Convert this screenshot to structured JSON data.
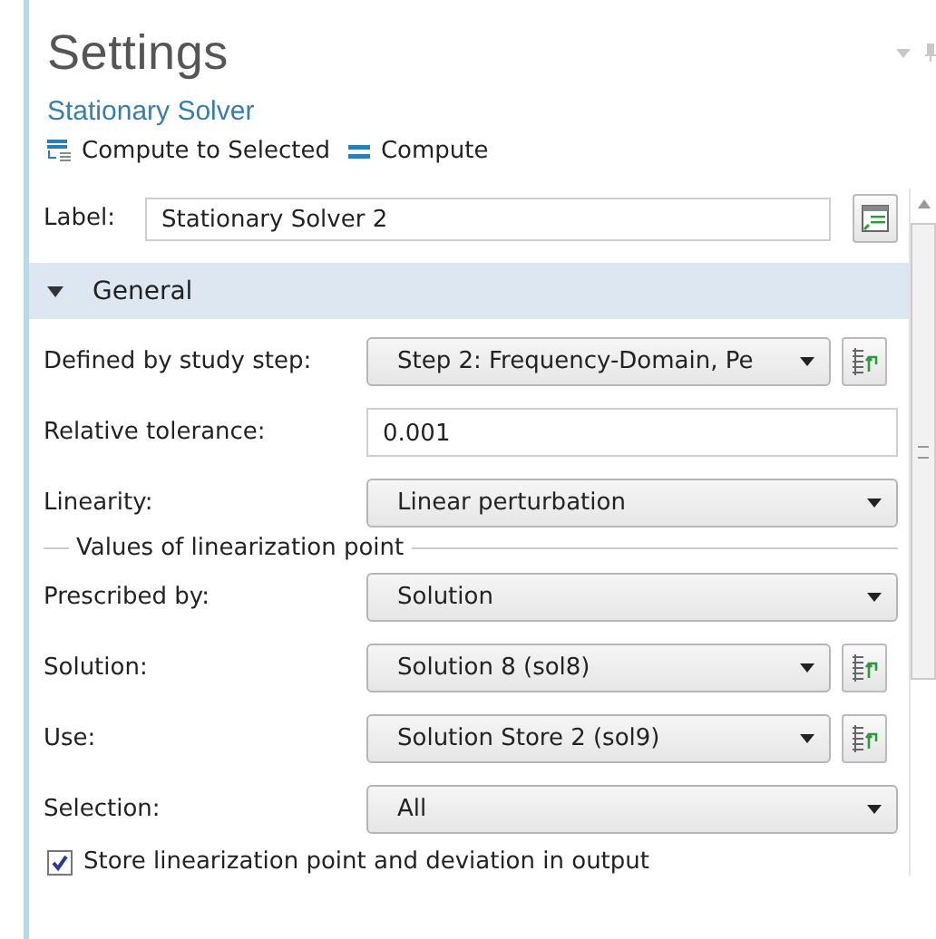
{
  "panel": {
    "title": "Settings",
    "subtitle": "Stationary Solver"
  },
  "toolbar": [
    {
      "kind": "compute-selected",
      "label": "Compute to Selected"
    },
    {
      "kind": "compute",
      "label": "Compute"
    }
  ],
  "label_field": {
    "label": "Label:",
    "value": "Stationary Solver 2"
  },
  "section": {
    "title": "General",
    "expanded": true
  },
  "rows": [
    {
      "kind": "select-button",
      "label": "Defined by study step:",
      "value": "Step 2: Frequency-Domain, Pe"
    },
    {
      "kind": "input",
      "label": "Relative tolerance:",
      "value": "0.001"
    },
    {
      "kind": "select",
      "label": "Linearity:",
      "value": "Linear perturbation"
    },
    {
      "kind": "group",
      "label": "Values of linearization point"
    },
    {
      "kind": "select",
      "label": "Prescribed by:",
      "value": "Solution"
    },
    {
      "kind": "select-button",
      "label": "Solution:",
      "value": "Solution 8 (sol8)"
    },
    {
      "kind": "select-button",
      "label": "Use:",
      "value": "Solution Store 2 (sol9)"
    },
    {
      "kind": "select",
      "label": "Selection:",
      "value": "All"
    }
  ],
  "checkbox": {
    "label": "Store linearization point and deviation in output",
    "checked": true
  }
}
